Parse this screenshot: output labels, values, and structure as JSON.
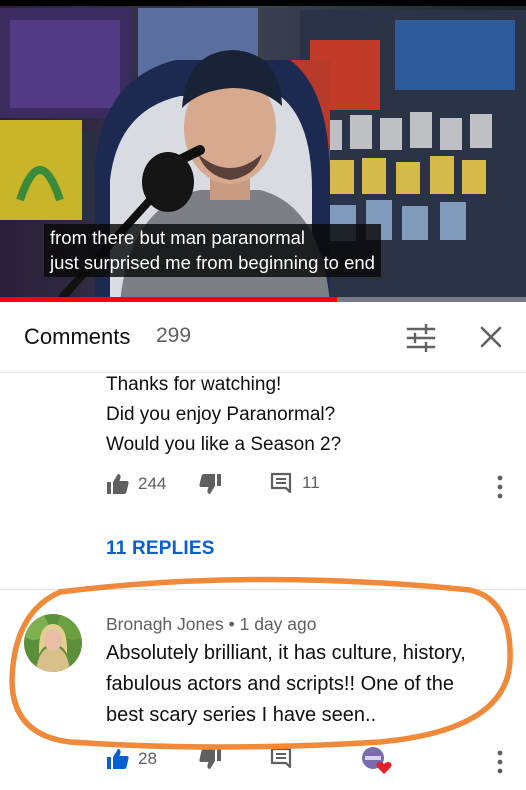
{
  "video": {
    "caption_lines": [
      "from there but man paranormal",
      "just surprised me from beginning to end"
    ],
    "progress": 0.64,
    "progress_color": "#ff0000"
  },
  "comments_panel": {
    "title": "Comments",
    "count": "299",
    "sort_icon": "sort-filter-icon",
    "close_icon": "close-icon"
  },
  "pinned_comment": {
    "text_lines": [
      "Thanks for watching!",
      "Did you enjoy Paranormal?",
      "Would you like a Season 2?"
    ],
    "likes": "244",
    "replies_count": "11",
    "replies_link": "11 REPLIES"
  },
  "comment": {
    "author": "Bronagh Jones",
    "separator": "•",
    "time": "1 day ago",
    "text_lines": [
      "Absolutely brilliant, it has culture, history,",
      "fabulous actors and scripts!! One of the",
      "best scary series I have seen.."
    ],
    "likes": "28"
  },
  "colors": {
    "link_blue": "#065fd4",
    "secondary_text": "#606060",
    "highlight_orange": "#f08a3a",
    "liked_blue": "#065fd4"
  }
}
